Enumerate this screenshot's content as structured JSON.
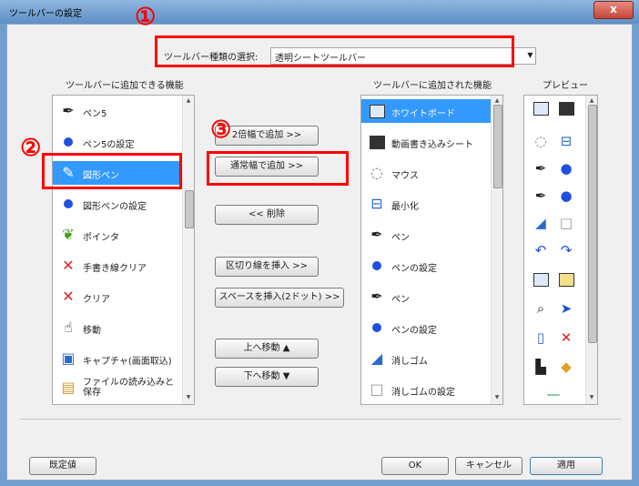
{
  "window": {
    "title": "ツールバーの設定",
    "close_label": "x"
  },
  "toolbar_type": {
    "label": "ツールバー種類の選択:",
    "value": "透明シートツールバー"
  },
  "available": {
    "header": "ツールバーに追加できる機能",
    "items": [
      {
        "label": "ペン5"
      },
      {
        "label": "ペン5の設定"
      },
      {
        "label": "図形ペン"
      },
      {
        "label": "図形ペンの設定"
      },
      {
        "label": "ポインタ"
      },
      {
        "label": "手書き線クリア"
      },
      {
        "label": "クリア"
      },
      {
        "label": "移動"
      },
      {
        "label": "キャプチャ(画面取込)"
      },
      {
        "label": "ファイルの読み込みと保存"
      }
    ]
  },
  "actions": {
    "add_double": "2倍幅で追加 >>",
    "add_normal": "通常幅で追加 >>",
    "remove": "<< 削除",
    "insert_separator": "区切り線を挿入 >>",
    "insert_space": "スペースを挿入(2ドット) >>",
    "move_up": "上へ移動 ▲",
    "move_down": "下へ移動 ▼"
  },
  "added": {
    "header": "ツールバーに追加された機能",
    "items": [
      {
        "label": "ホワイトボード"
      },
      {
        "label": "動画書き込みシート"
      },
      {
        "label": "マウス"
      },
      {
        "label": "最小化"
      },
      {
        "label": "ペン"
      },
      {
        "label": "ペンの設定"
      },
      {
        "label": "ペン"
      },
      {
        "label": "ペンの設定"
      },
      {
        "label": "消しゴム"
      },
      {
        "label": "消しゴムの設定"
      }
    ]
  },
  "preview": {
    "header": "プレビュー"
  },
  "footer": {
    "default_label": "既定値",
    "ok_label": "OK",
    "cancel_label": "キャンセル",
    "apply_label": "適用"
  },
  "annotations": {
    "n1": "①",
    "n2": "②",
    "n3": "③"
  },
  "colors": {
    "highlight": "#3399ff",
    "annotation": "#ff0000",
    "dot": "#1f4fe0"
  }
}
